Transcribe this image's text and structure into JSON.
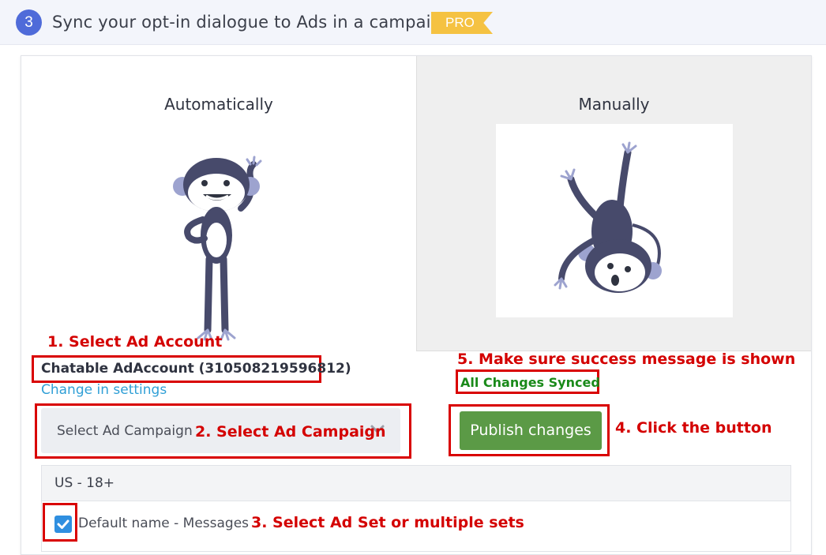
{
  "header": {
    "step_number": "3",
    "title": "Sync your opt-in dialogue to Ads in a campaign",
    "badge": "PRO"
  },
  "panels": {
    "auto_title": "Automatically",
    "manual_title": "Manually"
  },
  "account": {
    "name": "Chatable AdAccount (310508219596812)",
    "change_link": "Change in settings"
  },
  "campaign_select": {
    "placeholder": "Select Ad Campaign"
  },
  "status": {
    "synced_text": "All Changes Synced"
  },
  "actions": {
    "publish_label": "Publish changes"
  },
  "adsets": {
    "group_header": "US - 18+",
    "items": [
      {
        "label": "Default name - Messages",
        "checked": true
      }
    ]
  },
  "annotations": {
    "step1": "1. Select Ad Account",
    "step2": "2. Select Ad Campaign",
    "step3": "3. Select Ad Set or multiple sets",
    "step4": "4. Click the button",
    "step5": "5. Make sure success message is shown"
  },
  "colors": {
    "accent": "#4f6bd9",
    "pro_badge": "#f5c242",
    "publish_button": "#5b9a46",
    "success_text": "#1a8a1a",
    "link": "#2f9fd6",
    "annotation_red": "#d40000",
    "checkbox": "#2f8fe0"
  },
  "icons": {
    "dropdown": "chevron-down-icon",
    "checkbox": "check-icon"
  }
}
